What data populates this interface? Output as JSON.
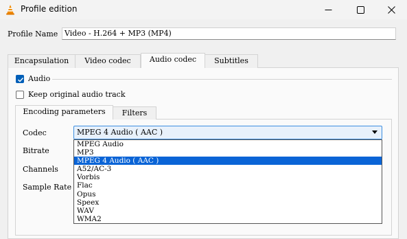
{
  "window": {
    "title": "Profile edition",
    "controls": {
      "minimize": "minimize",
      "maximize": "maximize",
      "close": "close"
    }
  },
  "profile": {
    "label": "Profile Name",
    "value": "Video - H.264 + MP3 (MP4)"
  },
  "tabs": [
    {
      "label": "Encapsulation"
    },
    {
      "label": "Video codec"
    },
    {
      "label": "Audio codec",
      "active": true
    },
    {
      "label": "Subtitles"
    }
  ],
  "audio": {
    "checkbox_label": "Audio",
    "checked": true,
    "keep_original_label": "Keep original audio track",
    "keep_original_checked": false
  },
  "subtabs": [
    {
      "label": "Encoding parameters",
      "active": true
    },
    {
      "label": "Filters"
    }
  ],
  "fields": {
    "codec_label": "Codec",
    "bitrate_label": "Bitrate",
    "channels_label": "Channels",
    "sample_rate_label": "Sample Rate"
  },
  "codec": {
    "selected": "MPEG 4 Audio ( AAC )",
    "options": [
      "MPEG Audio",
      "MP3",
      "MPEG 4 Audio ( AAC )",
      "A52/AC-3",
      "Vorbis",
      "Flac",
      "Opus",
      "Speex",
      "WAV",
      "WMA2"
    ],
    "highlighted_index": 2
  },
  "colors": {
    "accent": "#005fb8",
    "highlight": "#0a64d6",
    "vlc_orange": "#f08a00"
  }
}
